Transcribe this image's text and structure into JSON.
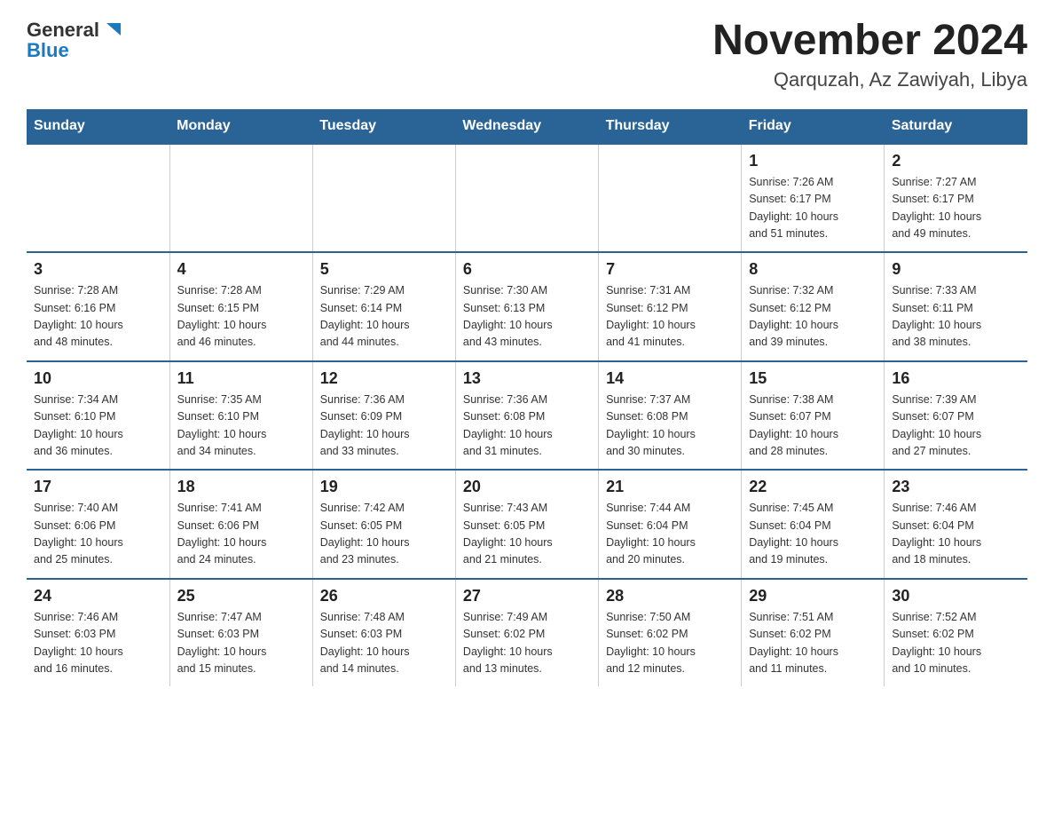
{
  "header": {
    "logo_general": "General",
    "logo_blue": "Blue",
    "month_title": "November 2024",
    "location": "Qarquzah, Az Zawiyah, Libya"
  },
  "days_of_week": [
    "Sunday",
    "Monday",
    "Tuesday",
    "Wednesday",
    "Thursday",
    "Friday",
    "Saturday"
  ],
  "weeks": [
    [
      {
        "day": "",
        "info": ""
      },
      {
        "day": "",
        "info": ""
      },
      {
        "day": "",
        "info": ""
      },
      {
        "day": "",
        "info": ""
      },
      {
        "day": "",
        "info": ""
      },
      {
        "day": "1",
        "info": "Sunrise: 7:26 AM\nSunset: 6:17 PM\nDaylight: 10 hours\nand 51 minutes."
      },
      {
        "day": "2",
        "info": "Sunrise: 7:27 AM\nSunset: 6:17 PM\nDaylight: 10 hours\nand 49 minutes."
      }
    ],
    [
      {
        "day": "3",
        "info": "Sunrise: 7:28 AM\nSunset: 6:16 PM\nDaylight: 10 hours\nand 48 minutes."
      },
      {
        "day": "4",
        "info": "Sunrise: 7:28 AM\nSunset: 6:15 PM\nDaylight: 10 hours\nand 46 minutes."
      },
      {
        "day": "5",
        "info": "Sunrise: 7:29 AM\nSunset: 6:14 PM\nDaylight: 10 hours\nand 44 minutes."
      },
      {
        "day": "6",
        "info": "Sunrise: 7:30 AM\nSunset: 6:13 PM\nDaylight: 10 hours\nand 43 minutes."
      },
      {
        "day": "7",
        "info": "Sunrise: 7:31 AM\nSunset: 6:12 PM\nDaylight: 10 hours\nand 41 minutes."
      },
      {
        "day": "8",
        "info": "Sunrise: 7:32 AM\nSunset: 6:12 PM\nDaylight: 10 hours\nand 39 minutes."
      },
      {
        "day": "9",
        "info": "Sunrise: 7:33 AM\nSunset: 6:11 PM\nDaylight: 10 hours\nand 38 minutes."
      }
    ],
    [
      {
        "day": "10",
        "info": "Sunrise: 7:34 AM\nSunset: 6:10 PM\nDaylight: 10 hours\nand 36 minutes."
      },
      {
        "day": "11",
        "info": "Sunrise: 7:35 AM\nSunset: 6:10 PM\nDaylight: 10 hours\nand 34 minutes."
      },
      {
        "day": "12",
        "info": "Sunrise: 7:36 AM\nSunset: 6:09 PM\nDaylight: 10 hours\nand 33 minutes."
      },
      {
        "day": "13",
        "info": "Sunrise: 7:36 AM\nSunset: 6:08 PM\nDaylight: 10 hours\nand 31 minutes."
      },
      {
        "day": "14",
        "info": "Sunrise: 7:37 AM\nSunset: 6:08 PM\nDaylight: 10 hours\nand 30 minutes."
      },
      {
        "day": "15",
        "info": "Sunrise: 7:38 AM\nSunset: 6:07 PM\nDaylight: 10 hours\nand 28 minutes."
      },
      {
        "day": "16",
        "info": "Sunrise: 7:39 AM\nSunset: 6:07 PM\nDaylight: 10 hours\nand 27 minutes."
      }
    ],
    [
      {
        "day": "17",
        "info": "Sunrise: 7:40 AM\nSunset: 6:06 PM\nDaylight: 10 hours\nand 25 minutes."
      },
      {
        "day": "18",
        "info": "Sunrise: 7:41 AM\nSunset: 6:06 PM\nDaylight: 10 hours\nand 24 minutes."
      },
      {
        "day": "19",
        "info": "Sunrise: 7:42 AM\nSunset: 6:05 PM\nDaylight: 10 hours\nand 23 minutes."
      },
      {
        "day": "20",
        "info": "Sunrise: 7:43 AM\nSunset: 6:05 PM\nDaylight: 10 hours\nand 21 minutes."
      },
      {
        "day": "21",
        "info": "Sunrise: 7:44 AM\nSunset: 6:04 PM\nDaylight: 10 hours\nand 20 minutes."
      },
      {
        "day": "22",
        "info": "Sunrise: 7:45 AM\nSunset: 6:04 PM\nDaylight: 10 hours\nand 19 minutes."
      },
      {
        "day": "23",
        "info": "Sunrise: 7:46 AM\nSunset: 6:04 PM\nDaylight: 10 hours\nand 18 minutes."
      }
    ],
    [
      {
        "day": "24",
        "info": "Sunrise: 7:46 AM\nSunset: 6:03 PM\nDaylight: 10 hours\nand 16 minutes."
      },
      {
        "day": "25",
        "info": "Sunrise: 7:47 AM\nSunset: 6:03 PM\nDaylight: 10 hours\nand 15 minutes."
      },
      {
        "day": "26",
        "info": "Sunrise: 7:48 AM\nSunset: 6:03 PM\nDaylight: 10 hours\nand 14 minutes."
      },
      {
        "day": "27",
        "info": "Sunrise: 7:49 AM\nSunset: 6:02 PM\nDaylight: 10 hours\nand 13 minutes."
      },
      {
        "day": "28",
        "info": "Sunrise: 7:50 AM\nSunset: 6:02 PM\nDaylight: 10 hours\nand 12 minutes."
      },
      {
        "day": "29",
        "info": "Sunrise: 7:51 AM\nSunset: 6:02 PM\nDaylight: 10 hours\nand 11 minutes."
      },
      {
        "day": "30",
        "info": "Sunrise: 7:52 AM\nSunset: 6:02 PM\nDaylight: 10 hours\nand 10 minutes."
      }
    ]
  ]
}
